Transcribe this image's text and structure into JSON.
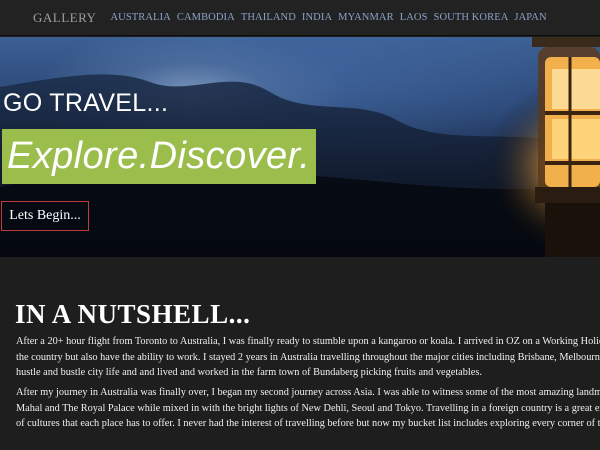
{
  "nav": {
    "brand": "GALLERY",
    "links": [
      "AUSTRALIA",
      "CAMBODIA",
      "THAILAND",
      "INDIA",
      "MYANMAR",
      "LAOS",
      "SOUTH KOREA",
      "JAPAN"
    ]
  },
  "hero": {
    "heading": "GO TRAVEL...",
    "slogan": "Explore.Discover.",
    "button_label": "Lets Begin..."
  },
  "section": {
    "title": "IN A NUTSHELL...",
    "paragraph_1": [
      "After a 20+ hour flight from Toronto to Australia, I was finally ready to stumble upon a kangaroo or koala. I arrived in OZ on a Working Holiday",
      "the country but also have the ability to work. I stayed 2 years in Australia travelling throughout the major cities including Brisbane, Melbourne, Sy",
      "hustle and bustle city life and and lived and worked in the farm town of Bundaberg picking fruits and vegetables."
    ],
    "paragraph_2": [
      "After my journey in Australia was finally over, I began my second journey across Asia. I was able to witness some of the most amazing landmarks",
      "Mahal and The Royal Palace while mixed in with the bright lights of New Dehli, Seoul and Tokyo. Travelling in a foreign country is a great experie",
      "of cultures that each place has to offer. I never had the interest of travelling before but now my bucket list includes exploring every corner of the"
    ]
  },
  "colors": {
    "navbar_bg": "#222222",
    "nav_link": "#8aa3c9",
    "slogan_bg": "#9bbd4c",
    "button_border": "#c03b3b",
    "page_bg": "#1e1e1e"
  }
}
